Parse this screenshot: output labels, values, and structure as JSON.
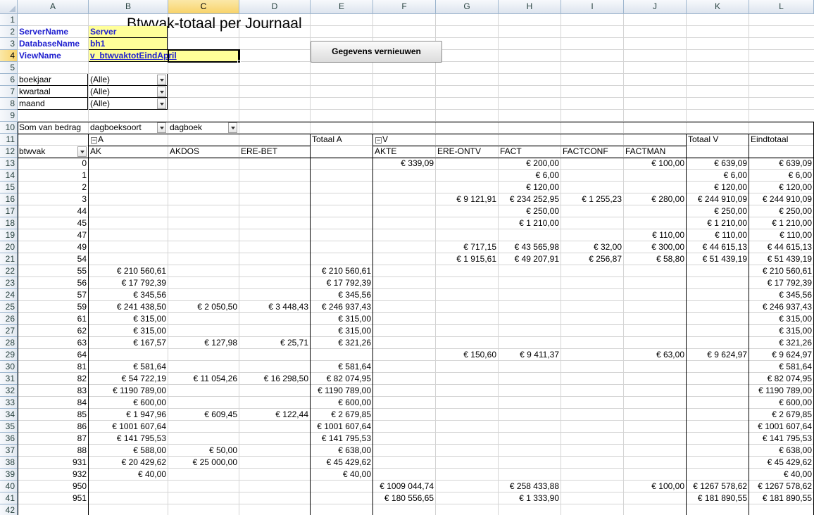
{
  "columns": [
    "A",
    "B",
    "C",
    "D",
    "E",
    "F",
    "G",
    "H",
    "I",
    "J",
    "K",
    "L"
  ],
  "selected_column": "C",
  "selected_row": 4,
  "title": "Btwvak-totaal per Journaal",
  "params": [
    {
      "label": "ServerName",
      "value": "Server"
    },
    {
      "label": "DatabaseName",
      "value": "bh1"
    },
    {
      "label": "ViewName",
      "value": "v_btwvaktotEindApril"
    }
  ],
  "refresh_button": "Gegevens vernieuwen",
  "filters": [
    {
      "label": "boekjaar",
      "value": "(Alle)"
    },
    {
      "label": "kwartaal",
      "value": "(Alle)"
    },
    {
      "label": "maand",
      "value": "(Alle)"
    }
  ],
  "pivot": {
    "data_label": "Som van bedrag",
    "col_field_1": "dagboeksoort",
    "col_field_2": "dagboek",
    "row_field": "btwvak",
    "group_a": "A",
    "group_v": "V",
    "total_a": "Totaal A",
    "total_v": "Totaal V",
    "grand_total": "Eindtotaal",
    "col_headers": [
      "AK",
      "AKDOS",
      "ERE-BET",
      "",
      "AKTE",
      "ERE-ONTV",
      "FACT",
      "FACTCONF",
      "FACTMAN",
      "",
      ""
    ],
    "rows": [
      {
        "btwvak": "0",
        "AK": "",
        "AKDOS": "",
        "EREBET": "",
        "TA": "",
        "AKTE": "€ 339,09",
        "EREONTV": "",
        "FACT": "€ 200,00",
        "FACTCONF": "",
        "FACTMAN": "€ 100,00",
        "TV": "€ 639,09",
        "ET": "€ 639,09"
      },
      {
        "btwvak": "1",
        "AK": "",
        "AKDOS": "",
        "EREBET": "",
        "TA": "",
        "AKTE": "",
        "EREONTV": "",
        "FACT": "€ 6,00",
        "FACTCONF": "",
        "FACTMAN": "",
        "TV": "€ 6,00",
        "ET": "€ 6,00"
      },
      {
        "btwvak": "2",
        "AK": "",
        "AKDOS": "",
        "EREBET": "",
        "TA": "",
        "AKTE": "",
        "EREONTV": "",
        "FACT": "€ 120,00",
        "FACTCONF": "",
        "FACTMAN": "",
        "TV": "€ 120,00",
        "ET": "€ 120,00"
      },
      {
        "btwvak": "3",
        "AK": "",
        "AKDOS": "",
        "EREBET": "",
        "TA": "",
        "AKTE": "",
        "EREONTV": "€ 9 121,91",
        "FACT": "€ 234 252,95",
        "FACTCONF": "€ 1 255,23",
        "FACTMAN": "€ 280,00",
        "TV": "€ 244 910,09",
        "ET": "€ 244 910,09"
      },
      {
        "btwvak": "44",
        "AK": "",
        "AKDOS": "",
        "EREBET": "",
        "TA": "",
        "AKTE": "",
        "EREONTV": "",
        "FACT": "€ 250,00",
        "FACTCONF": "",
        "FACTMAN": "",
        "TV": "€ 250,00",
        "ET": "€ 250,00"
      },
      {
        "btwvak": "45",
        "AK": "",
        "AKDOS": "",
        "EREBET": "",
        "TA": "",
        "AKTE": "",
        "EREONTV": "",
        "FACT": "€ 1 210,00",
        "FACTCONF": "",
        "FACTMAN": "",
        "TV": "€ 1 210,00",
        "ET": "€ 1 210,00"
      },
      {
        "btwvak": "47",
        "AK": "",
        "AKDOS": "",
        "EREBET": "",
        "TA": "",
        "AKTE": "",
        "EREONTV": "",
        "FACT": "",
        "FACTCONF": "",
        "FACTMAN": "€ 110,00",
        "TV": "€ 110,00",
        "ET": "€ 110,00"
      },
      {
        "btwvak": "49",
        "AK": "",
        "AKDOS": "",
        "EREBET": "",
        "TA": "",
        "AKTE": "",
        "EREONTV": "€ 717,15",
        "FACT": "€ 43 565,98",
        "FACTCONF": "€ 32,00",
        "FACTMAN": "€ 300,00",
        "TV": "€ 44 615,13",
        "ET": "€ 44 615,13"
      },
      {
        "btwvak": "54",
        "AK": "",
        "AKDOS": "",
        "EREBET": "",
        "TA": "",
        "AKTE": "",
        "EREONTV": "€ 1 915,61",
        "FACT": "€ 49 207,91",
        "FACTCONF": "€ 256,87",
        "FACTMAN": "€ 58,80",
        "TV": "€ 51 439,19",
        "ET": "€ 51 439,19"
      },
      {
        "btwvak": "55",
        "AK": "€ 210 560,61",
        "AKDOS": "",
        "EREBET": "",
        "TA": "€ 210 560,61",
        "AKTE": "",
        "EREONTV": "",
        "FACT": "",
        "FACTCONF": "",
        "FACTMAN": "",
        "TV": "",
        "ET": "€ 210 560,61"
      },
      {
        "btwvak": "56",
        "AK": "€ 17 792,39",
        "AKDOS": "",
        "EREBET": "",
        "TA": "€ 17 792,39",
        "AKTE": "",
        "EREONTV": "",
        "FACT": "",
        "FACTCONF": "",
        "FACTMAN": "",
        "TV": "",
        "ET": "€ 17 792,39"
      },
      {
        "btwvak": "57",
        "AK": "€ 345,56",
        "AKDOS": "",
        "EREBET": "",
        "TA": "€ 345,56",
        "AKTE": "",
        "EREONTV": "",
        "FACT": "",
        "FACTCONF": "",
        "FACTMAN": "",
        "TV": "",
        "ET": "€ 345,56"
      },
      {
        "btwvak": "59",
        "AK": "€ 241 438,50",
        "AKDOS": "€ 2 050,50",
        "EREBET": "€ 3 448,43",
        "TA": "€ 246 937,43",
        "AKTE": "",
        "EREONTV": "",
        "FACT": "",
        "FACTCONF": "",
        "FACTMAN": "",
        "TV": "",
        "ET": "€ 246 937,43"
      },
      {
        "btwvak": "61",
        "AK": "€ 315,00",
        "AKDOS": "",
        "EREBET": "",
        "TA": "€ 315,00",
        "AKTE": "",
        "EREONTV": "",
        "FACT": "",
        "FACTCONF": "",
        "FACTMAN": "",
        "TV": "",
        "ET": "€ 315,00"
      },
      {
        "btwvak": "62",
        "AK": "€ 315,00",
        "AKDOS": "",
        "EREBET": "",
        "TA": "€ 315,00",
        "AKTE": "",
        "EREONTV": "",
        "FACT": "",
        "FACTCONF": "",
        "FACTMAN": "",
        "TV": "",
        "ET": "€ 315,00"
      },
      {
        "btwvak": "63",
        "AK": "€ 167,57",
        "AKDOS": "€ 127,98",
        "EREBET": "€ 25,71",
        "TA": "€ 321,26",
        "AKTE": "",
        "EREONTV": "",
        "FACT": "",
        "FACTCONF": "",
        "FACTMAN": "",
        "TV": "",
        "ET": "€ 321,26"
      },
      {
        "btwvak": "64",
        "AK": "",
        "AKDOS": "",
        "EREBET": "",
        "TA": "",
        "AKTE": "",
        "EREONTV": "€ 150,60",
        "FACT": "€ 9 411,37",
        "FACTCONF": "",
        "FACTMAN": "€ 63,00",
        "TV": "€ 9 624,97",
        "ET": "€ 9 624,97"
      },
      {
        "btwvak": "81",
        "AK": "€ 581,64",
        "AKDOS": "",
        "EREBET": "",
        "TA": "€ 581,64",
        "AKTE": "",
        "EREONTV": "",
        "FACT": "",
        "FACTCONF": "",
        "FACTMAN": "",
        "TV": "",
        "ET": "€ 581,64"
      },
      {
        "btwvak": "82",
        "AK": "€ 54 722,19",
        "AKDOS": "€ 11 054,26",
        "EREBET": "€ 16 298,50",
        "TA": "€ 82 074,95",
        "AKTE": "",
        "EREONTV": "",
        "FACT": "",
        "FACTCONF": "",
        "FACTMAN": "",
        "TV": "",
        "ET": "€ 82 074,95"
      },
      {
        "btwvak": "83",
        "AK": "€ 1190 789,00",
        "AKDOS": "",
        "EREBET": "",
        "TA": "€ 1190 789,00",
        "AKTE": "",
        "EREONTV": "",
        "FACT": "",
        "FACTCONF": "",
        "FACTMAN": "",
        "TV": "",
        "ET": "€ 1190 789,00"
      },
      {
        "btwvak": "84",
        "AK": "€ 600,00",
        "AKDOS": "",
        "EREBET": "",
        "TA": "€ 600,00",
        "AKTE": "",
        "EREONTV": "",
        "FACT": "",
        "FACTCONF": "",
        "FACTMAN": "",
        "TV": "",
        "ET": "€ 600,00"
      },
      {
        "btwvak": "85",
        "AK": "€ 1 947,96",
        "AKDOS": "€ 609,45",
        "EREBET": "€ 122,44",
        "TA": "€ 2 679,85",
        "AKTE": "",
        "EREONTV": "",
        "FACT": "",
        "FACTCONF": "",
        "FACTMAN": "",
        "TV": "",
        "ET": "€ 2 679,85"
      },
      {
        "btwvak": "86",
        "AK": "€ 1001 607,64",
        "AKDOS": "",
        "EREBET": "",
        "TA": "€ 1001 607,64",
        "AKTE": "",
        "EREONTV": "",
        "FACT": "",
        "FACTCONF": "",
        "FACTMAN": "",
        "TV": "",
        "ET": "€ 1001 607,64"
      },
      {
        "btwvak": "87",
        "AK": "€ 141 795,53",
        "AKDOS": "",
        "EREBET": "",
        "TA": "€ 141 795,53",
        "AKTE": "",
        "EREONTV": "",
        "FACT": "",
        "FACTCONF": "",
        "FACTMAN": "",
        "TV": "",
        "ET": "€ 141 795,53"
      },
      {
        "btwvak": "88",
        "AK": "€ 588,00",
        "AKDOS": "€ 50,00",
        "EREBET": "",
        "TA": "€ 638,00",
        "AKTE": "",
        "EREONTV": "",
        "FACT": "",
        "FACTCONF": "",
        "FACTMAN": "",
        "TV": "",
        "ET": "€ 638,00"
      },
      {
        "btwvak": "931",
        "AK": "€ 20 429,62",
        "AKDOS": "€ 25 000,00",
        "EREBET": "",
        "TA": "€ 45 429,62",
        "AKTE": "",
        "EREONTV": "",
        "FACT": "",
        "FACTCONF": "",
        "FACTMAN": "",
        "TV": "",
        "ET": "€ 45 429,62"
      },
      {
        "btwvak": "932",
        "AK": "€ 40,00",
        "AKDOS": "",
        "EREBET": "",
        "TA": "€ 40,00",
        "AKTE": "",
        "EREONTV": "",
        "FACT": "",
        "FACTCONF": "",
        "FACTMAN": "",
        "TV": "",
        "ET": "€ 40,00"
      },
      {
        "btwvak": "950",
        "AK": "",
        "AKDOS": "",
        "EREBET": "",
        "TA": "",
        "AKTE": "€ 1009 044,74",
        "EREONTV": "",
        "FACT": "€ 258 433,88",
        "FACTCONF": "",
        "FACTMAN": "€ 100,00",
        "TV": "€ 1267 578,62",
        "ET": "€ 1267 578,62"
      },
      {
        "btwvak": "951",
        "AK": "",
        "AKDOS": "",
        "EREBET": "",
        "TA": "",
        "AKTE": "€ 180 556,65",
        "EREONTV": "",
        "FACT": "€ 1 333,90",
        "FACTCONF": "",
        "FACTMAN": "",
        "TV": "€ 181 890,55",
        "ET": "€ 181 890,55"
      }
    ]
  }
}
